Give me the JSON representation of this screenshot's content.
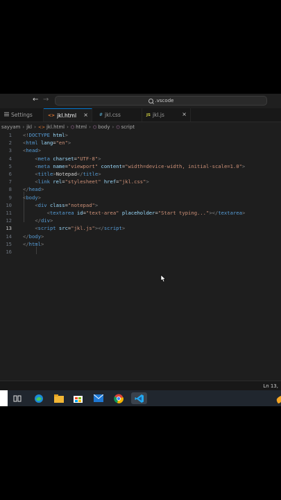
{
  "titlebar": {
    "back_arrow": "←",
    "forward_arrow": "→",
    "search_text": ".vscode"
  },
  "tabs": [
    {
      "label": "Settings",
      "icon": "settings-icon",
      "active": false
    },
    {
      "label": "jkl.html",
      "icon": "html-file-icon",
      "icon_glyph": "<>",
      "active": true,
      "close": "×"
    },
    {
      "label": "jkl.css",
      "icon": "css-file-icon",
      "icon_glyph": "#",
      "active": false
    },
    {
      "label": "jkl.js",
      "icon": "js-file-icon",
      "icon_glyph": "JS",
      "active": false,
      "close": "×"
    }
  ],
  "breadcrumb": {
    "items": [
      "sayyam",
      "jkl",
      "jkl.html",
      "html",
      "body",
      "script"
    ],
    "separator": "›"
  },
  "editor": {
    "current_line": 13,
    "lines": [
      {
        "n": "1",
        "tokens": [
          {
            "c": "br",
            "t": "<!"
          },
          {
            "c": "tg",
            "t": "DOCTYPE"
          },
          {
            "c": "at",
            "t": " html"
          },
          {
            "c": "br",
            "t": ">"
          }
        ]
      },
      {
        "n": "2",
        "tokens": [
          {
            "c": "br",
            "t": "<"
          },
          {
            "c": "tg",
            "t": "html"
          },
          {
            "c": "at",
            "t": " lang"
          },
          {
            "c": "tx",
            "t": "="
          },
          {
            "c": "st",
            "t": "\"en\""
          },
          {
            "c": "br",
            "t": ">"
          }
        ]
      },
      {
        "n": "3",
        "tokens": [
          {
            "c": "br",
            "t": "<"
          },
          {
            "c": "tg",
            "t": "head"
          },
          {
            "c": "br",
            "t": ">"
          }
        ]
      },
      {
        "n": "4",
        "tokens": [
          {
            "c": "tx",
            "t": "    "
          },
          {
            "c": "br",
            "t": "<"
          },
          {
            "c": "tg",
            "t": "meta"
          },
          {
            "c": "at",
            "t": " charset"
          },
          {
            "c": "tx",
            "t": "="
          },
          {
            "c": "st",
            "t": "\"UTF-8\""
          },
          {
            "c": "br",
            "t": ">"
          }
        ]
      },
      {
        "n": "5",
        "tokens": [
          {
            "c": "tx",
            "t": "    "
          },
          {
            "c": "br",
            "t": "<"
          },
          {
            "c": "tg",
            "t": "meta"
          },
          {
            "c": "at",
            "t": " name"
          },
          {
            "c": "tx",
            "t": "="
          },
          {
            "c": "st",
            "t": "\"viewport\""
          },
          {
            "c": "at",
            "t": " content"
          },
          {
            "c": "tx",
            "t": "="
          },
          {
            "c": "st",
            "t": "\"width=device-width, initial-scale=1.0\""
          },
          {
            "c": "br",
            "t": ">"
          }
        ]
      },
      {
        "n": "6",
        "tokens": [
          {
            "c": "tx",
            "t": "    "
          },
          {
            "c": "br",
            "t": "<"
          },
          {
            "c": "tg",
            "t": "title"
          },
          {
            "c": "br",
            "t": ">"
          },
          {
            "c": "tx",
            "t": "Notepad"
          },
          {
            "c": "br",
            "t": "</"
          },
          {
            "c": "tg",
            "t": "title"
          },
          {
            "c": "br",
            "t": ">"
          }
        ]
      },
      {
        "n": "7",
        "tokens": [
          {
            "c": "tx",
            "t": "    "
          },
          {
            "c": "br",
            "t": "<"
          },
          {
            "c": "tg",
            "t": "link"
          },
          {
            "c": "at",
            "t": " rel"
          },
          {
            "c": "tx",
            "t": "="
          },
          {
            "c": "st",
            "t": "\"stylesheet\""
          },
          {
            "c": "at",
            "t": " href"
          },
          {
            "c": "tx",
            "t": "="
          },
          {
            "c": "st",
            "t": "\"jkl.css\""
          },
          {
            "c": "br",
            "t": ">"
          }
        ]
      },
      {
        "n": "8",
        "tokens": [
          {
            "c": "br",
            "t": "</"
          },
          {
            "c": "tg",
            "t": "head"
          },
          {
            "c": "br",
            "t": ">"
          }
        ]
      },
      {
        "n": "9",
        "tokens": [
          {
            "c": "br",
            "t": "<"
          },
          {
            "c": "tg",
            "t": "body"
          },
          {
            "c": "br",
            "t": ">"
          }
        ]
      },
      {
        "n": "10",
        "tokens": [
          {
            "c": "tx",
            "t": "    "
          },
          {
            "c": "br",
            "t": "<"
          },
          {
            "c": "tg",
            "t": "div"
          },
          {
            "c": "at",
            "t": " class"
          },
          {
            "c": "tx",
            "t": "="
          },
          {
            "c": "st",
            "t": "\"notepad\""
          },
          {
            "c": "br",
            "t": ">"
          }
        ]
      },
      {
        "n": "11",
        "tokens": [
          {
            "c": "tx",
            "t": "        "
          },
          {
            "c": "br",
            "t": "<"
          },
          {
            "c": "tg",
            "t": "textarea"
          },
          {
            "c": "at",
            "t": " id"
          },
          {
            "c": "tx",
            "t": "="
          },
          {
            "c": "st",
            "t": "\"text-area\""
          },
          {
            "c": "at",
            "t": " placeholder"
          },
          {
            "c": "tx",
            "t": "="
          },
          {
            "c": "st",
            "t": "\"Start typing...\""
          },
          {
            "c": "br",
            "t": "></"
          },
          {
            "c": "tg",
            "t": "textarea"
          },
          {
            "c": "br",
            "t": ">"
          }
        ]
      },
      {
        "n": "12",
        "tokens": [
          {
            "c": "tx",
            "t": "    "
          },
          {
            "c": "br",
            "t": "</"
          },
          {
            "c": "tg",
            "t": "div"
          },
          {
            "c": "br",
            "t": ">"
          }
        ]
      },
      {
        "n": "13",
        "tokens": [
          {
            "c": "tx",
            "t": "    "
          },
          {
            "c": "br",
            "t": "<"
          },
          {
            "c": "tg",
            "t": "script"
          },
          {
            "c": "at",
            "t": " src"
          },
          {
            "c": "tx",
            "t": "="
          },
          {
            "c": "st",
            "t": "\"jkl.js\""
          },
          {
            "c": "br",
            "t": "></"
          },
          {
            "c": "tg",
            "t": "script"
          },
          {
            "c": "br",
            "t": ">"
          }
        ]
      },
      {
        "n": "14",
        "tokens": [
          {
            "c": "br",
            "t": "</"
          },
          {
            "c": "tg",
            "t": "body"
          },
          {
            "c": "br",
            "t": ">"
          }
        ]
      },
      {
        "n": "15",
        "tokens": [
          {
            "c": "br",
            "t": "</"
          },
          {
            "c": "tg",
            "t": "html"
          },
          {
            "c": "br",
            "t": ">"
          }
        ]
      },
      {
        "n": "16",
        "tokens": []
      }
    ]
  },
  "statusbar": {
    "position": "Ln 13,"
  },
  "taskbar": {
    "items": [
      {
        "name": "task-view-icon"
      },
      {
        "name": "edge-icon"
      },
      {
        "name": "file-explorer-icon"
      },
      {
        "name": "store-icon"
      },
      {
        "name": "mail-icon"
      },
      {
        "name": "chrome-icon"
      },
      {
        "name": "vscode-icon",
        "active": true
      }
    ]
  },
  "colors": {
    "editor_bg": "#1e1e1e",
    "tag": "#569cd6",
    "attribute": "#9cdcfe",
    "string": "#ce9178",
    "accent": "#0078d4"
  }
}
